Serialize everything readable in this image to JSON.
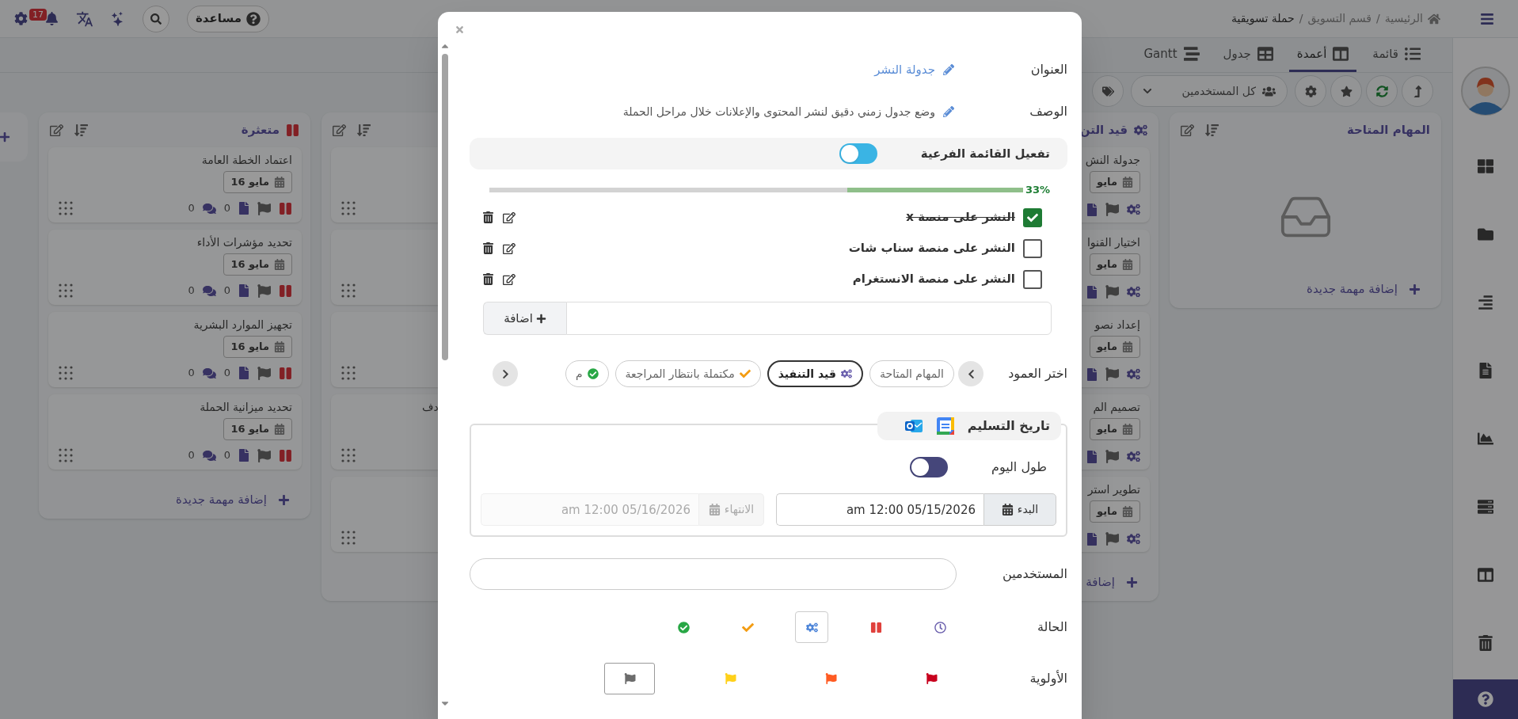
{
  "top_bar": {
    "breadcrumb": [
      "الرئيسية",
      "قسم التسويق",
      "حملة تسويقية"
    ],
    "separator": "/",
    "help_label": "مساعدة",
    "notification_count": "17"
  },
  "views": {
    "tabs": [
      {
        "label": "قائمة",
        "kind": "list",
        "selected": false
      },
      {
        "label": "أعمدة",
        "kind": "columns",
        "selected": true
      },
      {
        "label": "جدول",
        "kind": "table",
        "selected": false
      },
      {
        "label": "Gantt",
        "kind": "gantt",
        "selected": false
      }
    ]
  },
  "toolbar": {
    "users_filter": "كل المستخدمين"
  },
  "board": {
    "columns": [
      {
        "kind": "empty",
        "header": {
          "kind": "available",
          "title": "المهام المتاحة"
        },
        "add_label": "إضافة مهمة جديدة"
      },
      {
        "kind": "start_only",
        "header": {
          "kind": "in_progress",
          "title": "قيد التن"
        },
        "add_label": "إضافة",
        "cards": [
          {
            "title": "جدولة النش",
            "date": "مايو",
            "kind": "in_progress"
          },
          {
            "title": "اختيار القنوا",
            "date": "مايو",
            "kind": "in_progress"
          },
          {
            "title": "إعداد نصو",
            "date": "مايو",
            "kind": "in_progress"
          },
          {
            "title": "تصميم الم",
            "date": "مايو",
            "kind": "in_progress"
          },
          {
            "title": "تطوير استر",
            "date": "مايو",
            "kind": "in_progress"
          }
        ]
      },
      {
        "kind": "end_only",
        "cards": [
          {
            "draggable": true
          },
          {
            "draggable": true
          },
          {
            "draggable": true
          },
          {
            "title": "دف",
            "draggable": true
          },
          {
            "draggable": true
          }
        ]
      },
      {
        "kind": "full",
        "header": {
          "kind": "paused",
          "title": "متعثرة"
        },
        "add_label": "إضافة مهمة جديدة",
        "cards": [
          {
            "title": "اعتماد الخطة العامة",
            "date": "مايو 16",
            "kind": "paused",
            "attachments": "0",
            "comments": "0",
            "draggable": true
          },
          {
            "title": "تحديد مؤشرات الأداء",
            "date": "مايو 16",
            "kind": "paused",
            "attachments": "0",
            "comments": "0",
            "draggable": true
          },
          {
            "title": "تجهيز الموارد البشرية",
            "date": "مايو 16",
            "kind": "paused",
            "attachments": "0",
            "comments": "0",
            "draggable": true
          },
          {
            "title": "تحديد ميزانية الحملة",
            "date": "مايو 16",
            "kind": "paused",
            "attachments": "0",
            "comments": "0",
            "draggable": true
          }
        ]
      }
    ]
  },
  "task_modal": {
    "title": {
      "label": "العنوان",
      "value": "جدولة النشر"
    },
    "description": {
      "label": "الوصف",
      "value": "وضع جدول زمني دقيق لنشر المحتوى والإعلانات خلال مراحل الحملة"
    },
    "subtasks": {
      "label": "تفعيل القائمة الفرعية",
      "on": false,
      "level": 0.33,
      "percent": "33%",
      "add_label": "اضافة",
      "items": [
        {
          "text": "النشر على منصة x",
          "checked": true
        },
        {
          "text": "النشر على منصة سناب شات",
          "checked": false
        },
        {
          "text": "النشر على منصة الانستغرام",
          "checked": false
        }
      ]
    },
    "column_picker": {
      "label": "اختر العمود",
      "options": [
        {
          "label": "المهام المتاحة",
          "kind": "available",
          "selected": false
        },
        {
          "label": "قيد التنفيذ",
          "kind": "in_progress",
          "selected": true
        },
        {
          "label": "مكتملة بانتظار المراجعة",
          "kind": "review",
          "selected": false
        },
        {
          "label": "م",
          "kind": "done",
          "selected": false
        }
      ]
    },
    "delivery": {
      "title": "تاريخ التسليم",
      "all_day": {
        "label": "طول اليوم",
        "on": false
      },
      "start": {
        "label": "البدء",
        "value": "05/15/2026 12:00 am",
        "disabled": false
      },
      "end": {
        "label": "الانتهاء",
        "value": "05/16/2026 12:00 am",
        "disabled": true
      }
    },
    "users": {
      "label": "المستخدمين"
    },
    "status": {
      "label": "الحالة",
      "options": [
        {
          "kind": "pending",
          "selected": false
        },
        {
          "kind": "paused",
          "selected": false
        },
        {
          "kind": "in_progress",
          "selected": true
        },
        {
          "kind": "review",
          "selected": false
        },
        {
          "kind": "done",
          "selected": false
        }
      ]
    },
    "priority": {
      "label": "الأولوية",
      "options": [
        {
          "kind": "urgent",
          "selected": false
        },
        {
          "kind": "high",
          "selected": false
        },
        {
          "kind": "normal",
          "selected": false
        },
        {
          "kind": "low",
          "selected": true
        }
      ]
    }
  }
}
